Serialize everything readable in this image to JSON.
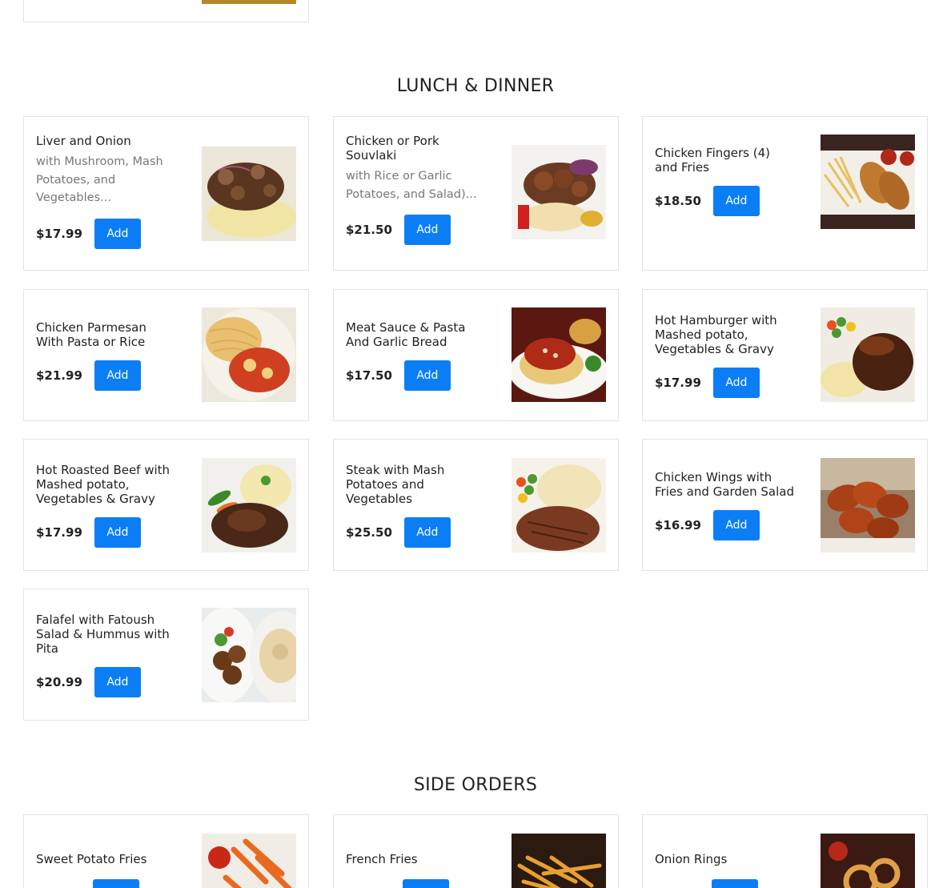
{
  "sections": {
    "lunch_title": "LUNCH & DINNER",
    "sides_title": "SIDE ORDERS"
  },
  "add_label": "Add",
  "lunch_items": [
    {
      "name": "Liver and Onion",
      "description": "with Mushroom, Mash Potatoes, and Vegetables...",
      "price": "$17.99",
      "image": "liver-onion-photo"
    },
    {
      "name": "Chicken or Pork Souvlaki",
      "description": "with Rice or Garlic Potatoes, and Salad)...",
      "price": "$21.50",
      "image": "souvlaki-photo"
    },
    {
      "name": "Chicken Fingers (4) and Fries",
      "description": "",
      "price": "$18.50",
      "image": "chicken-fingers-photo"
    },
    {
      "name": "Chicken Parmesan With Pasta or Rice",
      "description": "",
      "price": "$21.99",
      "image": "chicken-parmesan-photo"
    },
    {
      "name": "Meat Sauce & Pasta And Garlic Bread",
      "description": "",
      "price": "$17.50",
      "image": "meat-sauce-pasta-photo"
    },
    {
      "name": "Hot Hamburger with Mashed potato, Vegetables & Gravy",
      "description": "",
      "price": "$17.99",
      "image": "hot-hamburger-photo"
    },
    {
      "name": "Hot Roasted Beef with Mashed potato, Vegetables & Gravy",
      "description": "",
      "price": "$17.99",
      "image": "roasted-beef-photo"
    },
    {
      "name": "Steak with Mash Potatoes and Vegetables",
      "description": "",
      "price": "$25.50",
      "image": "steak-photo"
    },
    {
      "name": "Chicken Wings with Fries and Garden Salad",
      "description": "",
      "price": "$16.99",
      "image": "chicken-wings-photo"
    },
    {
      "name": "Falafel with Fatoush Salad & Hummus with Pita",
      "description": "",
      "price": "$20.99",
      "image": "falafel-photo"
    }
  ],
  "side_items": [
    {
      "name": "Sweet Potato Fries",
      "price": "",
      "image": "sweet-potato-fries-photo"
    },
    {
      "name": "French Fries",
      "price": "",
      "image": "french-fries-photo"
    },
    {
      "name": "Onion Rings",
      "price": "",
      "image": "onion-rings-photo"
    }
  ],
  "colors": {
    "accent": "#0b7ef5",
    "border": "#e3e3e3",
    "text": "#222222",
    "muted": "#777777"
  }
}
